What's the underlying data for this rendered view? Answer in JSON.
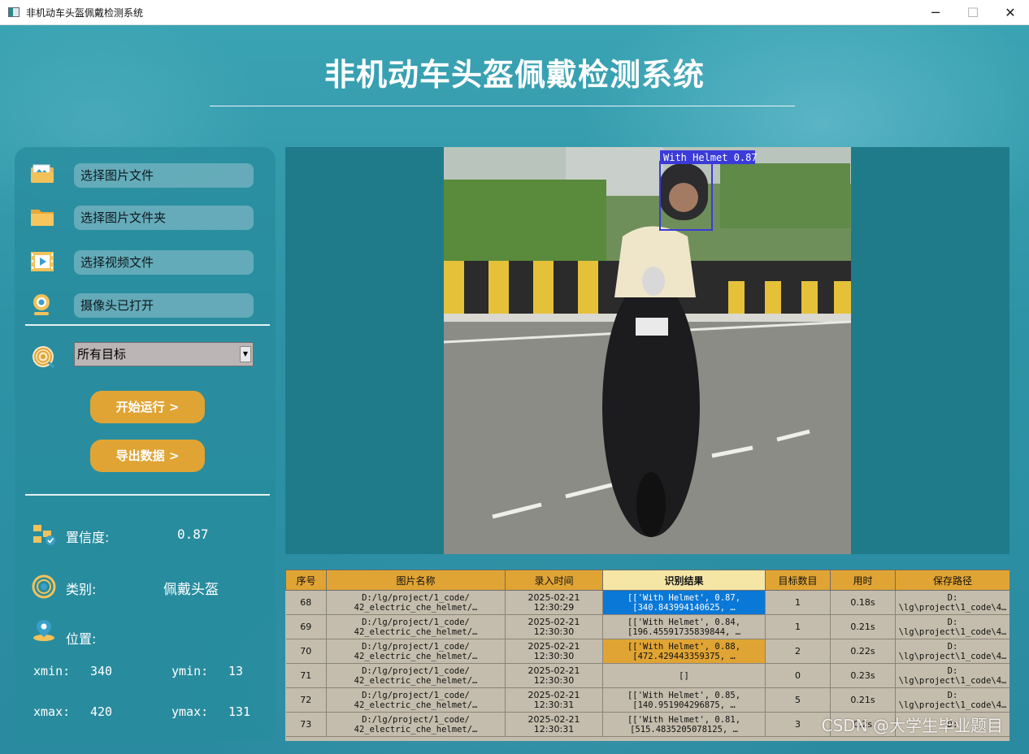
{
  "window": {
    "title": "非机动车头盔佩戴检测系统",
    "controls": [
      "─",
      "☐",
      "✕"
    ]
  },
  "header": {
    "title": "非机动车头盔佩戴检测系统"
  },
  "sidebar": {
    "buttons": [
      {
        "label": "选择图片文件",
        "icon": "image-folder-icon"
      },
      {
        "label": "选择图片文件夹",
        "icon": "folder-icon"
      },
      {
        "label": "选择视频文件",
        "icon": "video-file-icon"
      },
      {
        "label": "摄像头已打开",
        "icon": "webcam-icon"
      }
    ],
    "target_select": {
      "icon": "target-icon",
      "selected": "所有目标"
    },
    "start_button": "开始运行 >",
    "export_button": "导出数据 >",
    "confidence": {
      "label": "置信度:",
      "value": "0.87",
      "icon": "confidence-icon"
    },
    "category": {
      "label": "类别:",
      "value": "佩戴头盔",
      "icon": "category-icon"
    },
    "position": {
      "label": "位置:",
      "icon": "location-icon"
    },
    "coords": {
      "xmin_label": "xmin:",
      "xmin": "340",
      "ymin_label": "ymin:",
      "ymin": "13",
      "xmax_label": "xmax:",
      "xmax": "420",
      "ymax_label": "ymax:",
      "ymax": "131"
    }
  },
  "detection": {
    "box_label": "With Helmet 0.87",
    "box_color": "#3b3bd9"
  },
  "table": {
    "headers": [
      "序号",
      "图片名称",
      "录入时间",
      "识别结果",
      "目标数目",
      "用时",
      "保存路径"
    ],
    "active_header_index": 3,
    "rows": [
      {
        "id": "68",
        "name1": "D:/lg/project/1_code/",
        "name2": "42_electric_che_helmet/…",
        "time1": "2025-02-21",
        "time2": "12:30:29",
        "res1": "[['With Helmet', 0.87,",
        "res2": "[340.843994140625, …",
        "count": "1",
        "dur": "0.18s",
        "path1": "D:",
        "path2": "\\lg\\project\\1_code\\4…",
        "res_state": "blue"
      },
      {
        "id": "69",
        "name1": "D:/lg/project/1_code/",
        "name2": "42_electric_che_helmet/…",
        "time1": "2025-02-21",
        "time2": "12:30:30",
        "res1": "[['With Helmet', 0.84,",
        "res2": "[196.45591735839844, …",
        "count": "1",
        "dur": "0.21s",
        "path1": "D:",
        "path2": "\\lg\\project\\1_code\\4…",
        "res_state": "none"
      },
      {
        "id": "70",
        "name1": "D:/lg/project/1_code/",
        "name2": "42_electric_che_helmet/…",
        "time1": "2025-02-21",
        "time2": "12:30:30",
        "res1": "[['With Helmet', 0.88,",
        "res2": "[472.429443359375, …",
        "count": "2",
        "dur": "0.22s",
        "path1": "D:",
        "path2": "\\lg\\project\\1_code\\4…",
        "res_state": "orange"
      },
      {
        "id": "71",
        "name1": "D:/lg/project/1_code/",
        "name2": "42_electric_che_helmet/…",
        "time1": "2025-02-21",
        "time2": "12:30:30",
        "res1": "[]",
        "res2": "",
        "count": "0",
        "dur": "0.23s",
        "path1": "D:",
        "path2": "\\lg\\project\\1_code\\4…",
        "res_state": "none"
      },
      {
        "id": "72",
        "name1": "D:/lg/project/1_code/",
        "name2": "42_electric_che_helmet/…",
        "time1": "2025-02-21",
        "time2": "12:30:31",
        "res1": "[['With Helmet', 0.85,",
        "res2": "[140.951904296875, …",
        "count": "5",
        "dur": "0.21s",
        "path1": "D:",
        "path2": "\\lg\\project\\1_code\\4…",
        "res_state": "none"
      },
      {
        "id": "73",
        "name1": "D:/lg/project/1_code/",
        "name2": "42_electric_che_helmet/…",
        "time1": "2025-02-21",
        "time2": "12:30:31",
        "res1": "[['With Helmet', 0.81,",
        "res2": "[515.4835205078125, …",
        "count": "3",
        "dur": "0.2s",
        "path1": "D:",
        "path2": "",
        "res_state": "none"
      }
    ]
  },
  "watermark": "CSDN @大学生毕业题目",
  "colors": {
    "accent_orange": "#e0a434",
    "panel_teal": "#2a8aa0",
    "selected_blue": "#0a78d7"
  }
}
